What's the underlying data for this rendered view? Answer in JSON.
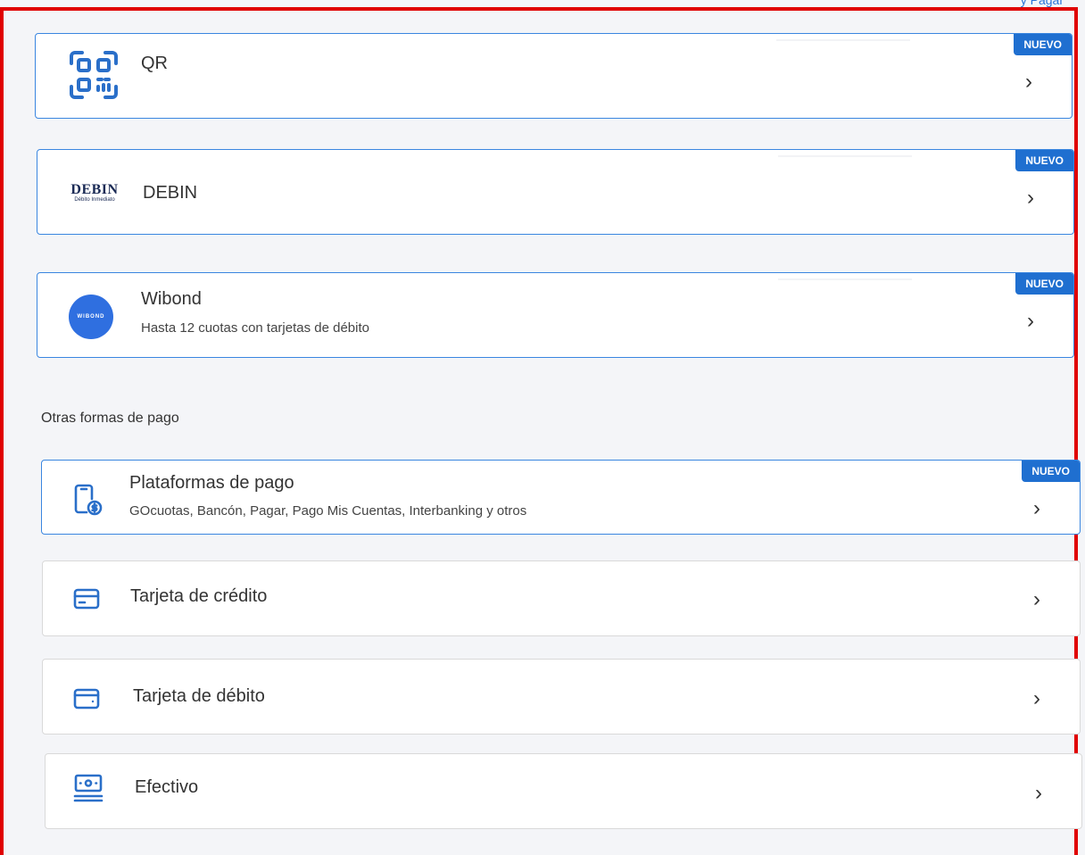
{
  "top_link": {
    "label": "y Pagar"
  },
  "featured": [
    {
      "title": "QR",
      "subtitle": "",
      "badge": "NUEVO",
      "icon": "qr-code-icon"
    },
    {
      "title": "DEBIN",
      "subtitle": "",
      "badge": "NUEVO",
      "icon": "debin-logo",
      "logo_text": "DEBIN",
      "logo_subtext": "Débito Inmediato"
    },
    {
      "title": "Wibond",
      "subtitle": "Hasta 12 cuotas con tarjetas de débito",
      "badge": "NUEVO",
      "icon": "wibond-logo",
      "logo_text": "WIBOND"
    }
  ],
  "section": {
    "heading": "Otras formas de pago"
  },
  "others": [
    {
      "title": "Plataformas de pago",
      "subtitle": "GOcuotas, Bancón, Pagar, Pago Mis Cuentas, Interbanking y otros",
      "badge": "NUEVO",
      "icon": "phone-payment-icon"
    },
    {
      "title": "Tarjeta de crédito",
      "icon": "credit-card-icon"
    },
    {
      "title": "Tarjeta de débito",
      "icon": "debit-card-icon"
    },
    {
      "title": "Efectivo",
      "icon": "cash-icon"
    }
  ],
  "chevron": "›",
  "colors": {
    "accent": "#1f6fd0",
    "frame": "#e00000",
    "icon": "#2a6fc9"
  }
}
